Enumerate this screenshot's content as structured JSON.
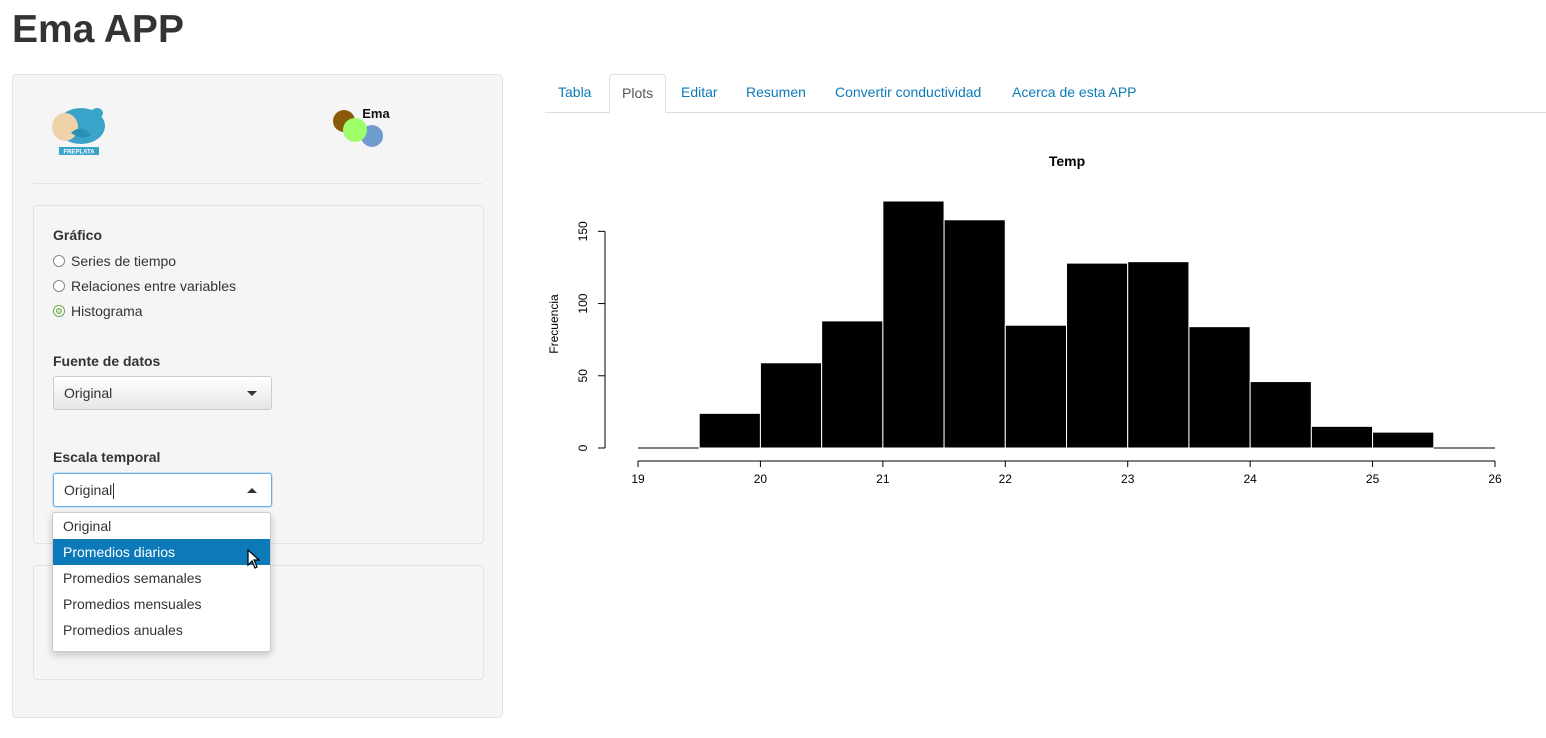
{
  "app": {
    "title": "Ema APP"
  },
  "logos": {
    "freplata_text": "FREPLATA",
    "ema_text": "Ema"
  },
  "grafico": {
    "label": "Gráfico",
    "options": [
      "Series de tiempo",
      "Relaciones entre variables",
      "Histograma"
    ],
    "selected": "Histograma"
  },
  "fuente": {
    "label": "Fuente de datos",
    "value": "Original"
  },
  "escala": {
    "label": "Escala temporal",
    "value": "Original",
    "options": [
      "Original",
      "Promedios diarios",
      "Promedios semanales",
      "Promedios mensuales",
      "Promedios anuales"
    ],
    "highlighted": "Promedios diarios"
  },
  "tabs": [
    "Tabla",
    "Plots",
    "Editar",
    "Resumen",
    "Convertir conductividad",
    "Acerca de esta APP"
  ],
  "active_tab": "Plots",
  "colors": {
    "accent": "#0c7ab8",
    "bar_fill": "#000000",
    "bar_border": "#ffffff"
  },
  "chart_data": {
    "type": "bar",
    "title": "Temp",
    "xlabel": "",
    "ylabel": "Frecuencia",
    "bin_edges": [
      19,
      19.5,
      20,
      20.5,
      21,
      21.5,
      22,
      22.5,
      23,
      23.5,
      24,
      24.5,
      25,
      25.5,
      26
    ],
    "values": [
      0,
      24,
      59,
      88,
      171,
      158,
      85,
      128,
      129,
      84,
      46,
      15,
      11,
      0
    ],
    "xlim": [
      19,
      26
    ],
    "ylim": [
      0,
      171
    ],
    "x_ticks": [
      "19",
      "20",
      "21",
      "22",
      "23",
      "24",
      "25",
      "26"
    ],
    "y_ticks": [
      "0",
      "50",
      "100",
      "150"
    ],
    "grid": false
  }
}
